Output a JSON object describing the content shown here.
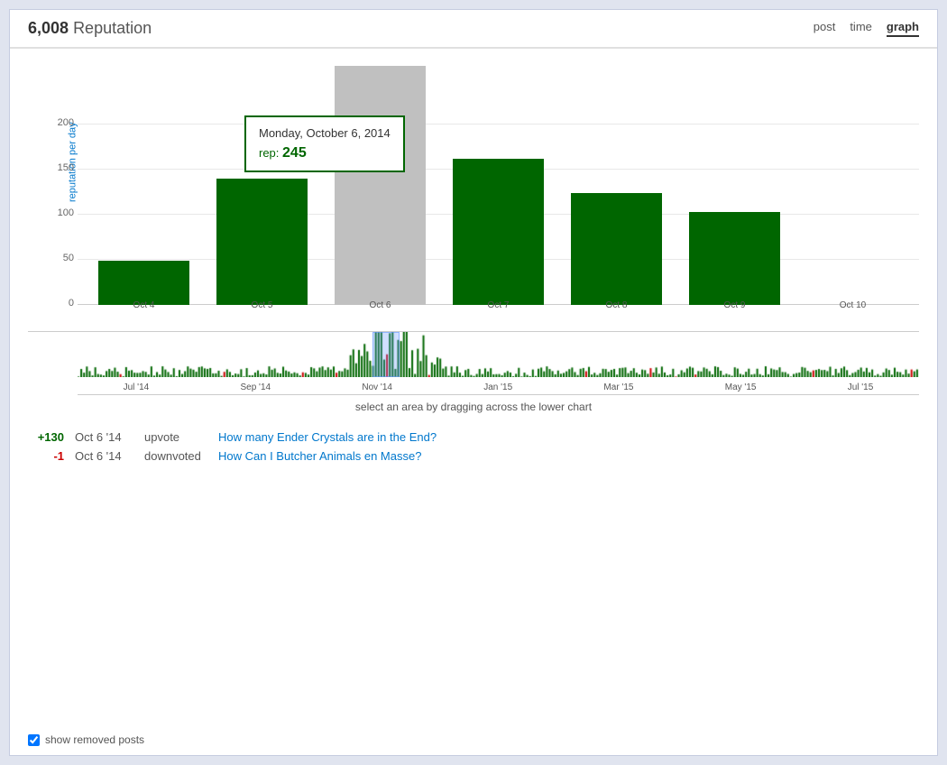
{
  "header": {
    "reputation_count": "6,008",
    "reputation_label": "Reputation",
    "nav": {
      "post": "post",
      "time": "time",
      "graph": "graph"
    }
  },
  "tooltip": {
    "date": "Monday, October 6, 2014",
    "rep_label": "rep:",
    "rep_value": "245"
  },
  "chart": {
    "y_axis_label": "reputation per day",
    "y_ticks": [
      {
        "value": 0,
        "label": "0"
      },
      {
        "value": 50,
        "label": "50"
      },
      {
        "value": 100,
        "label": "100"
      },
      {
        "value": 150,
        "label": "150"
      },
      {
        "value": 200,
        "label": "200"
      }
    ],
    "bars": [
      {
        "label": "Oct 4",
        "height_pct": 18,
        "highlighted": false
      },
      {
        "label": "Oct 4",
        "height_pct": 0,
        "highlighted": false
      },
      {
        "label": "Oct 5",
        "height_pct": 52,
        "highlighted": false
      },
      {
        "label": "Oct 5",
        "height_pct": 0,
        "highlighted": false
      },
      {
        "label": "Oct 6",
        "height_pct": 98,
        "highlighted": true
      },
      {
        "label": "Oct 6",
        "height_pct": 0,
        "highlighted": true
      },
      {
        "label": "Oct 7",
        "height_pct": 60,
        "highlighted": false
      },
      {
        "label": "Oct 7",
        "height_pct": 0,
        "highlighted": false
      },
      {
        "label": "Oct 8",
        "height_pct": 46,
        "highlighted": false
      },
      {
        "label": "Oct 8",
        "height_pct": 0,
        "highlighted": false
      },
      {
        "label": "Oct 9",
        "height_pct": 38,
        "highlighted": false
      },
      {
        "label": "Oct 9",
        "height_pct": 0,
        "highlighted": false
      },
      {
        "label": "Oct 10",
        "height_pct": 0,
        "highlighted": false
      },
      {
        "label": "Oct 10",
        "height_pct": 0,
        "highlighted": false
      }
    ],
    "x_labels": [
      "Oct 4",
      "Oct 4",
      "Oct 5",
      "Oct 5",
      "Oct 6",
      "Oct 6",
      "Oct 7",
      "Oct 7",
      "Oct 8",
      "Oct 8",
      "Oct 9",
      "Oct 9",
      "Oct 10",
      "Oct 10"
    ]
  },
  "mini_chart": {
    "x_labels": [
      "Jul '14",
      "Sep '14",
      "Nov '14",
      "Jan '15",
      "Mar '15",
      "May '15",
      "Jul '15"
    ]
  },
  "drag_hint": "select an area by dragging across the lower chart",
  "reputation_entries": [
    {
      "change": "+130",
      "is_positive": true,
      "date": "Oct 6 '14",
      "type": "upvote",
      "link_text": "How many Ender Crystals are in the End?"
    },
    {
      "change": "-1",
      "is_positive": false,
      "date": "Oct 6 '14",
      "type": "downvoted",
      "link_text": "How Can I Butcher Animals en Masse?"
    }
  ],
  "footer": {
    "checkbox_label": "show removed posts"
  }
}
